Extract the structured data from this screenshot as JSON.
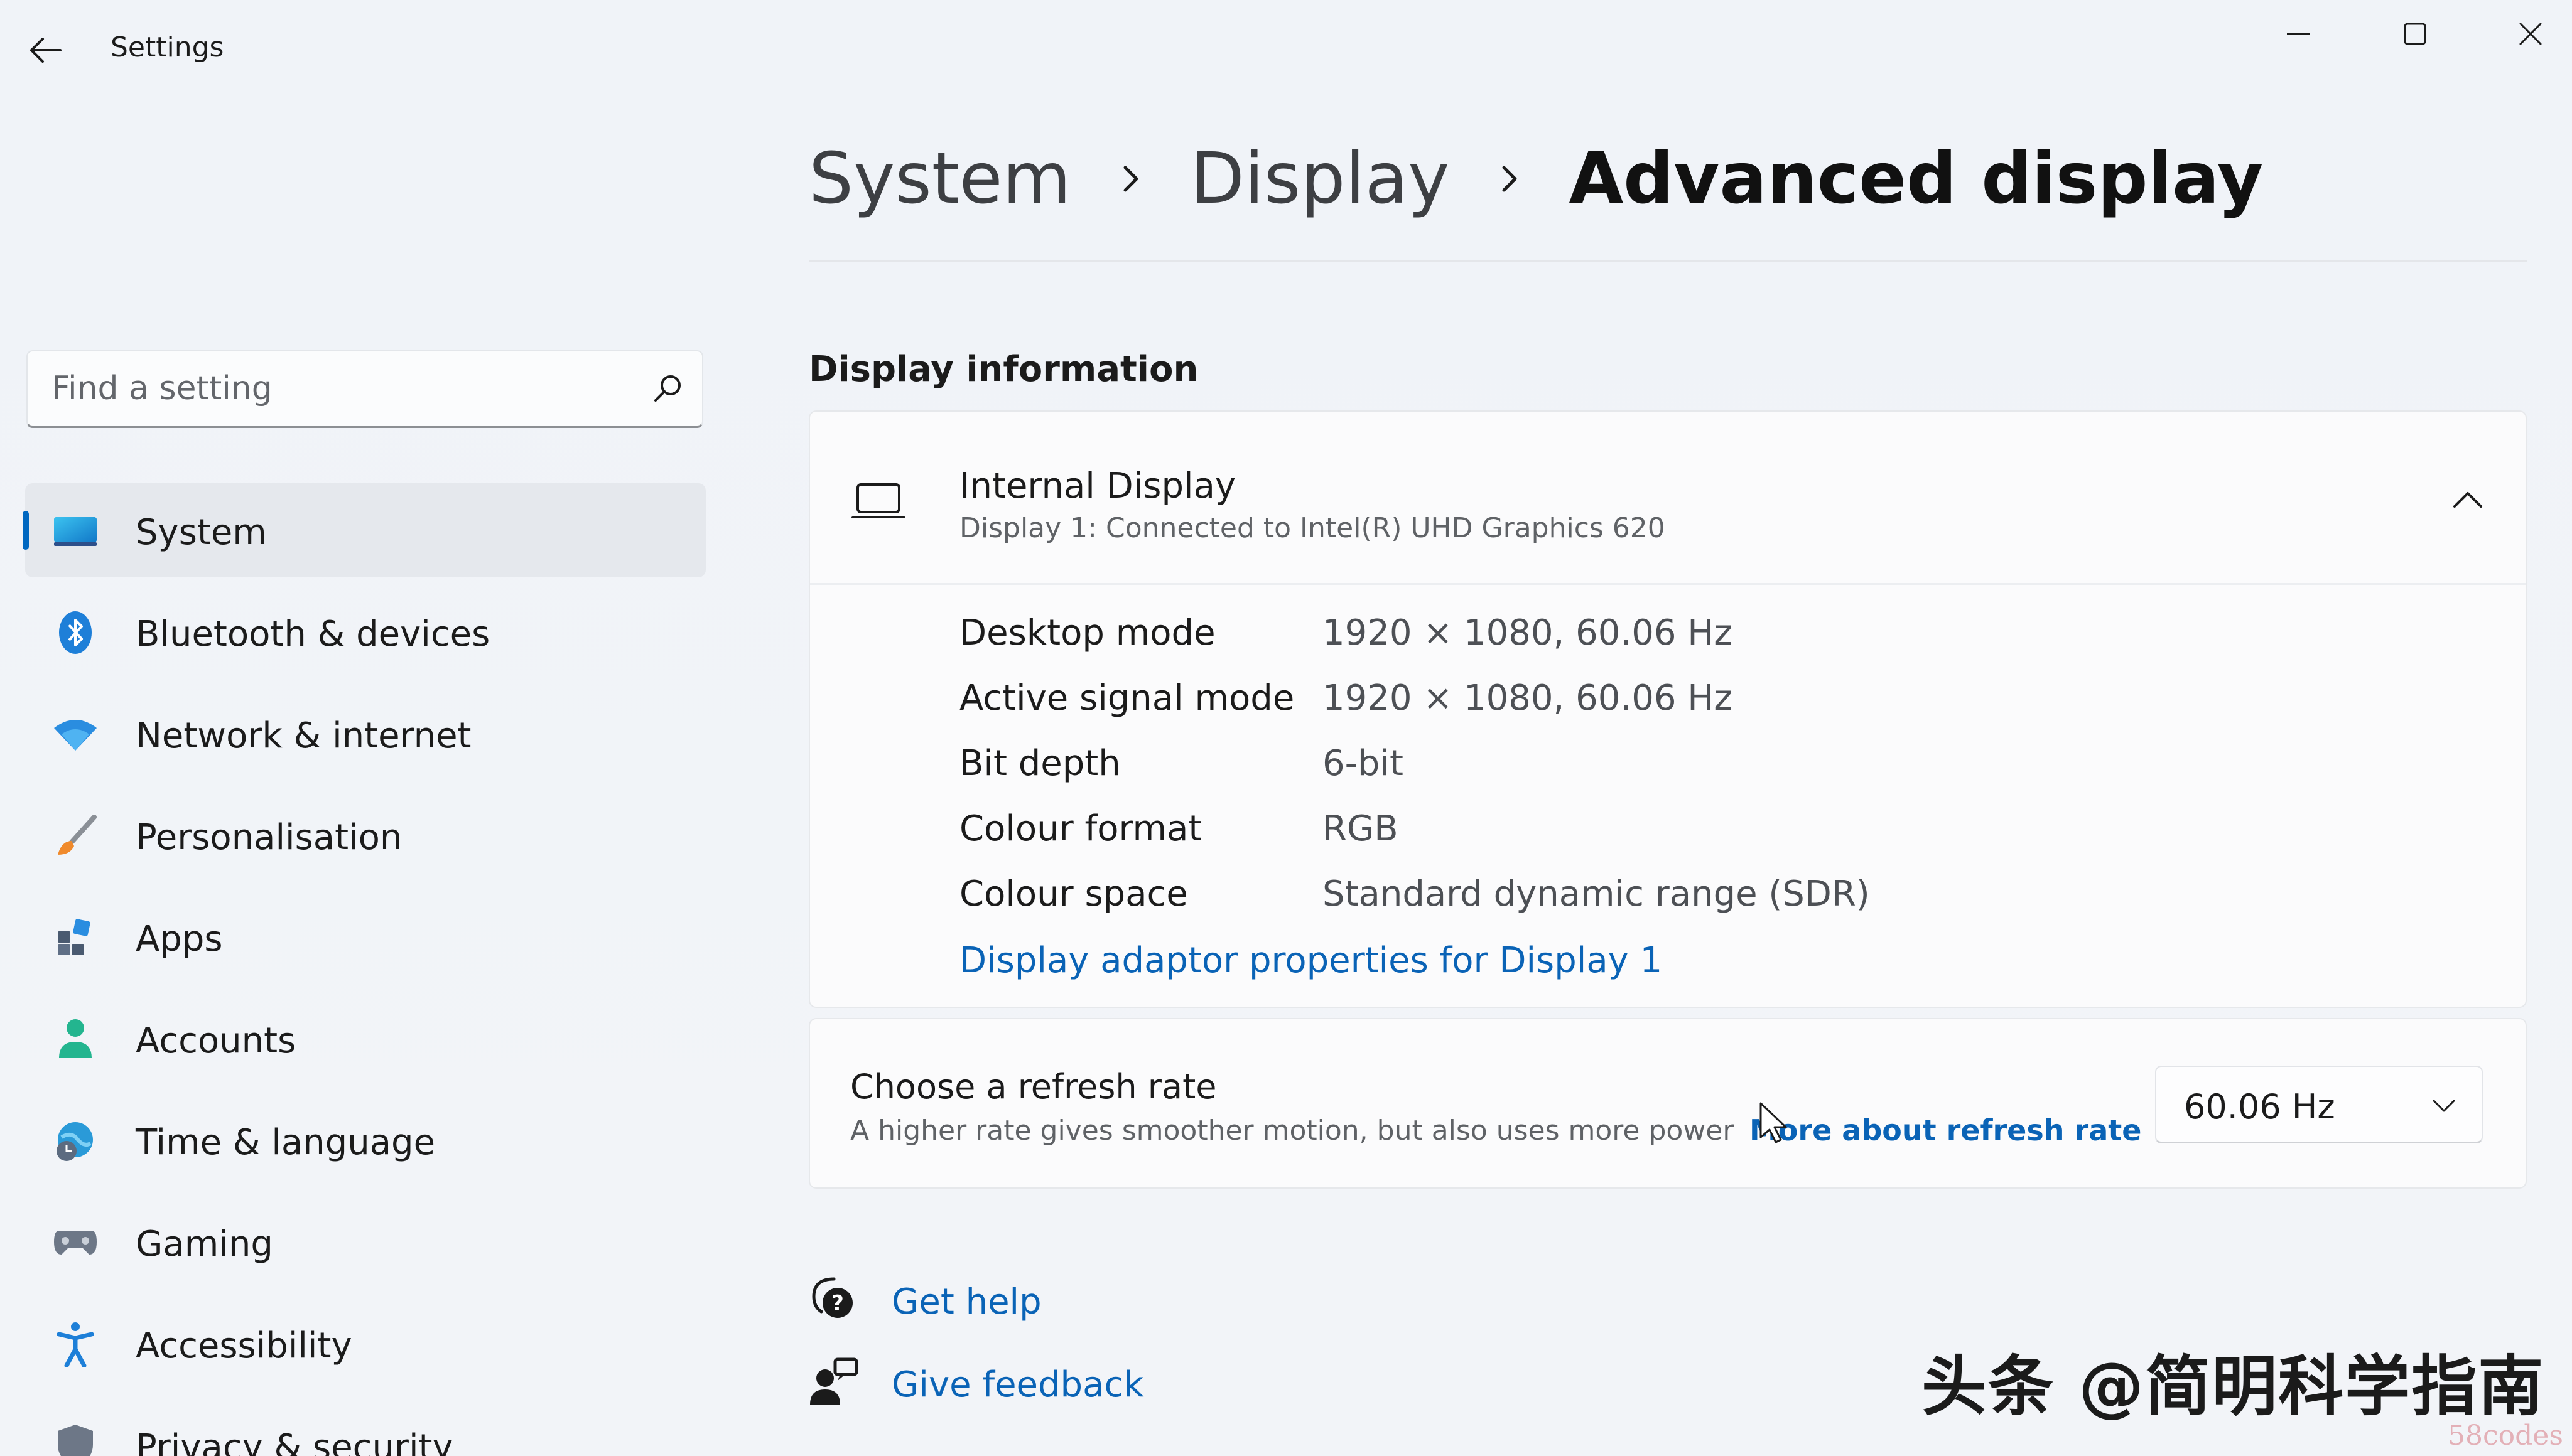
{
  "window": {
    "title": "Settings",
    "controls": {
      "minimize": "minimize-icon",
      "maximize": "maximize-icon",
      "close": "close-icon"
    }
  },
  "search": {
    "placeholder": "Find a setting",
    "value": ""
  },
  "sidebar": {
    "items": [
      {
        "label": "System",
        "icon": "system-icon",
        "selected": true
      },
      {
        "label": "Bluetooth & devices",
        "icon": "bluetooth-icon"
      },
      {
        "label": "Network & internet",
        "icon": "wifi-icon"
      },
      {
        "label": "Personalisation",
        "icon": "brush-icon"
      },
      {
        "label": "Apps",
        "icon": "apps-icon"
      },
      {
        "label": "Accounts",
        "icon": "accounts-icon"
      },
      {
        "label": "Time & language",
        "icon": "globe-clock-icon"
      },
      {
        "label": "Gaming",
        "icon": "gamepad-icon"
      },
      {
        "label": "Accessibility",
        "icon": "accessibility-icon"
      },
      {
        "label": "Privacy & security",
        "icon": "shield-icon"
      }
    ]
  },
  "breadcrumb": {
    "items": [
      "System",
      "Display",
      "Advanced display"
    ]
  },
  "display_info": {
    "section_title": "Display information",
    "display_name": "Internal Display",
    "display_sub": "Display 1: Connected to Intel(R) UHD Graphics 620",
    "rows": [
      {
        "label": "Desktop mode",
        "value": "1920 × 1080, 60.06 Hz"
      },
      {
        "label": "Active signal mode",
        "value": "1920 × 1080, 60.06 Hz"
      },
      {
        "label": "Bit depth",
        "value": "6-bit"
      },
      {
        "label": "Colour format",
        "value": "RGB"
      },
      {
        "label": "Colour space",
        "value": "Standard dynamic range (SDR)"
      }
    ],
    "adapter_link": "Display adaptor properties for Display 1"
  },
  "refresh": {
    "title": "Choose a refresh rate",
    "description": "A higher rate gives smoother motion, but also uses more power",
    "link": "More about refresh rate",
    "selected": "60.06 Hz"
  },
  "help": {
    "get_help": "Get help",
    "give_feedback": "Give feedback"
  },
  "watermark": {
    "text": "头条 @简明科学指南",
    "sub": "58codes"
  },
  "colors": {
    "accent": "#0067c0",
    "link": "#0a63b6"
  }
}
